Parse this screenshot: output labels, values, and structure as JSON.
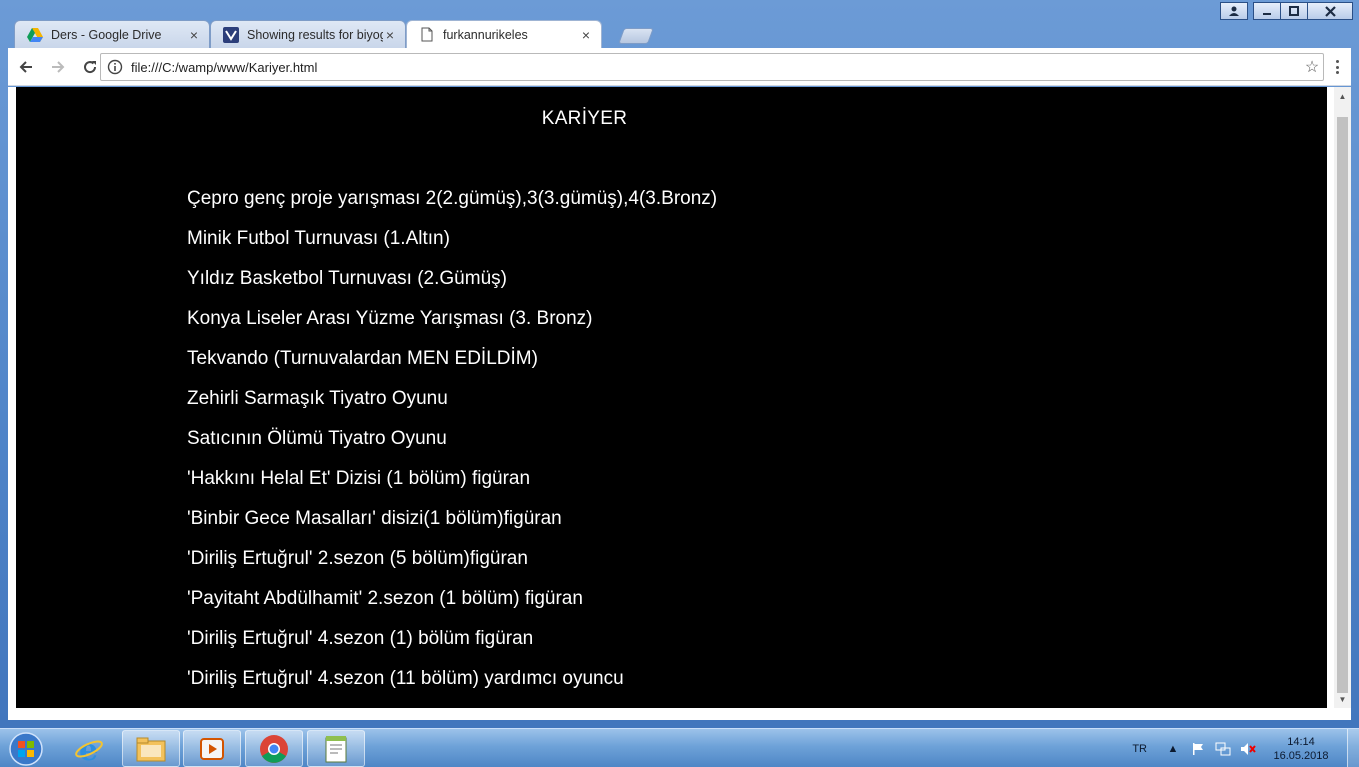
{
  "browser": {
    "tabs": [
      {
        "title": "Ders - Google Drive",
        "icon": "google-drive-icon"
      },
      {
        "title": "Showing results for biyog",
        "icon": "site-logo-icon"
      },
      {
        "title": "furkannurikeles",
        "icon": "document-icon"
      }
    ],
    "url": "file:///C:/wamp/www/Kariyer.html"
  },
  "page": {
    "heading": "KARİYER",
    "items": [
      "Çepro genç proje yarışması 2(2.gümüş),3(3.gümüş),4(3.Bronz)",
      "Minik Futbol Turnuvası (1.Altın)",
      "Yıldız Basketbol Turnuvası (2.Gümüş)",
      "Konya Liseler Arası Yüzme Yarışması (3. Bronz)",
      "Tekvando (Turnuvalardan MEN EDİLDİM)",
      "Zehirli Sarmaşık Tiyatro Oyunu",
      "Satıcının Ölümü Tiyatro Oyunu",
      "'Hakkını Helal Et' Dizisi (1 bölüm) figüran",
      "'Binbir Gece Masalları' disizi(1 bölüm)figüran",
      "'Diriliş Ertuğrul' 2.sezon (5 bölüm)figüran",
      "'Payitaht Abdülhamit' 2.sezon (1 bölüm) figüran",
      "'Diriliş Ertuğrul' 4.sezon (1) bölüm figüran",
      "'Diriliş Ertuğrul' 4.sezon (11 bölüm) yardımcı oyuncu"
    ]
  },
  "taskbar": {
    "language": "TR",
    "time": "14:14",
    "date": "16.05.2018"
  }
}
